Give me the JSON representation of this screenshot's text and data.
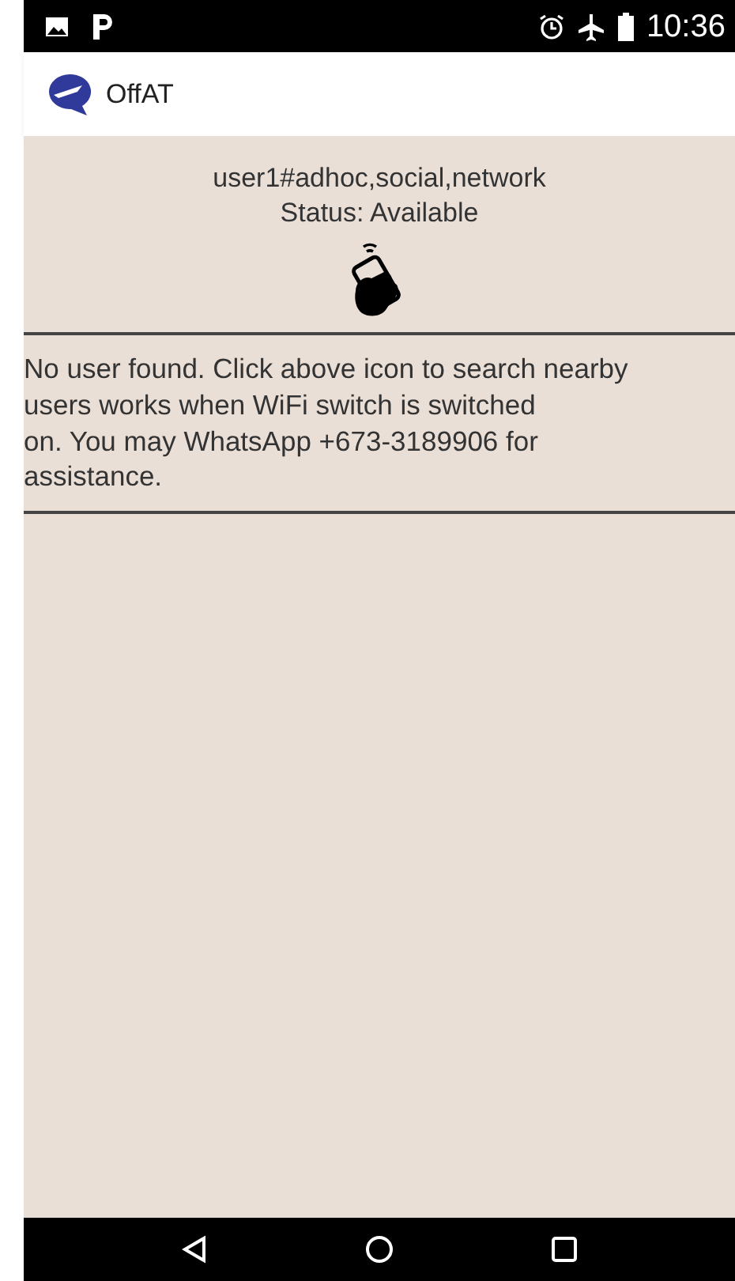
{
  "status_bar": {
    "time": "10:36"
  },
  "app_bar": {
    "title": "OffAT"
  },
  "profile": {
    "name": "user1#adhoc,social,network",
    "status": "Status: Available"
  },
  "message_lines": [
    "No user found. Click above icon to search nearby",
    "users works when WiFi switch is switched",
    "on. You may WhatsApp +673-3189906 for",
    "assistance."
  ]
}
